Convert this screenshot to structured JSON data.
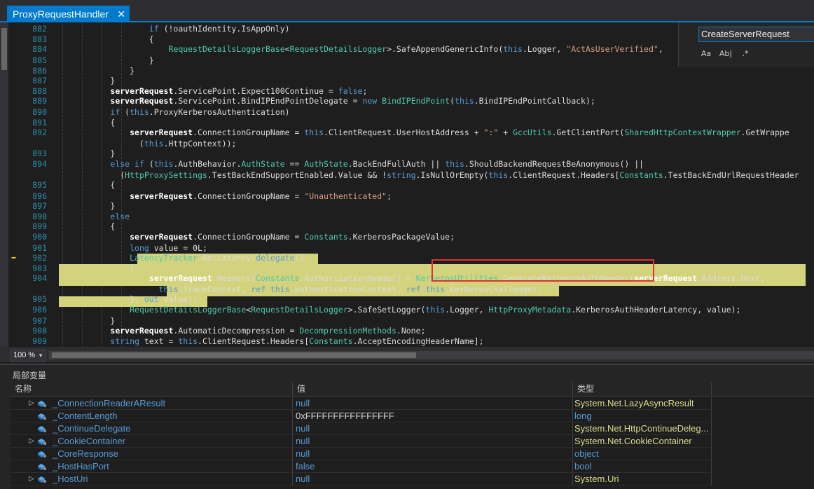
{
  "tab": {
    "title": "ProxyRequestHandler",
    "close": "✕"
  },
  "find": {
    "query": "CreateServerRequest",
    "opt_case": "Aa",
    "opt_word": "Ab|",
    "opt_regex": ".*"
  },
  "zoom": {
    "value": "100 %"
  },
  "code": {
    "lines": [
      {
        "n": "882",
        "t": "                if (!oauthIdentity.IsAppOnly)"
      },
      {
        "n": "883",
        "t": "                {"
      },
      {
        "n": "884",
        "t": "                    RequestDetailsLoggerBase<RequestDetailsLogger>.SafeAppendGenericInfo(this.Logger, \"ActAsUserVerified\","
      },
      {
        "n": "885",
        "t": "                }"
      },
      {
        "n": "886",
        "t": "            }"
      },
      {
        "n": "887",
        "t": "        }"
      },
      {
        "n": "888",
        "t": "        serverRequest.ServicePoint.Expect100Continue = false;"
      },
      {
        "n": "889",
        "t": "        serverRequest.ServicePoint.BindIPEndPointDelegate = new BindIPEndPoint(this.BindIPEndPointCallback);"
      },
      {
        "n": "890",
        "t": "        if (this.ProxyKerberosAuthentication)"
      },
      {
        "n": "891",
        "t": "        {"
      },
      {
        "n": "892",
        "t": "            serverRequest.ConnectionGroupName = this.ClientRequest.UserHostAddress + \":\" + GccUtils.GetClientPort(SharedHttpContextWrapper.GetWrappe"
      },
      {
        "n": "",
        "t": "              (this.HttpContext));"
      },
      {
        "n": "893",
        "t": "        }"
      },
      {
        "n": "894",
        "t": "        else if (this.AuthBehavior.AuthState == AuthState.BackEndFullAuth || this.ShouldBackendRequestBeAnonymous() ||"
      },
      {
        "n": "",
        "t": "          (HttpProxySettings.TestBackEndSupportEnabled.Value && !string.IsNullOrEmpty(this.ClientRequest.Headers[Constants.TestBackEndUrlRequestHeader"
      },
      {
        "n": "895",
        "t": "        {"
      },
      {
        "n": "896",
        "t": "            serverRequest.ConnectionGroupName = \"Unauthenticated\";"
      },
      {
        "n": "897",
        "t": "        }"
      },
      {
        "n": "898",
        "t": "        else"
      },
      {
        "n": "899",
        "t": "        {"
      },
      {
        "n": "900",
        "t": "            serverRequest.ConnectionGroupName = Constants.KerberosPackageValue;"
      },
      {
        "n": "901",
        "t": "            long value = 0L;"
      },
      {
        "n": "902",
        "t": "            LatencyTracker.GetLatency(delegate()"
      },
      {
        "n": "903",
        "t": "            {"
      },
      {
        "n": "904",
        "t": "                serverRequest.Headers[Constants.AuthorizationHeader] = KerberosUtilities.GenerateKerberosAuthHeader(serverRequest.Address.Host,"
      },
      {
        "n": "",
        "t": "                  this.TraceContext, ref this.authenticationContext, ref this.kerberosChallenge);"
      },
      {
        "n": "905",
        "t": "            }, out value);"
      },
      {
        "n": "906",
        "t": "            RequestDetailsLoggerBase<RequestDetailsLogger>.SafeSetLogger(this.Logger, HttpProxyMetadata.KerberosAuthHeaderLatency, value);"
      },
      {
        "n": "907",
        "t": "        }"
      },
      {
        "n": "908",
        "t": "        serverRequest.AutomaticDecompression = DecompressionMethods.None;"
      },
      {
        "n": "909",
        "t": "        string text = this.ClientRequest.Headers[Constants.AcceptEncodingHeaderName];"
      }
    ]
  },
  "locals": {
    "title": "局部变量",
    "headers": {
      "name": "名称",
      "value": "值",
      "type": "类型"
    },
    "rows": [
      {
        "expand": "▷",
        "name": "_ConnectionReaderAResult",
        "value": "null",
        "type_ns": "System.Net.",
        "type_name": "LazyAsyncResult"
      },
      {
        "expand": "",
        "name": "_ContentLength",
        "value": "0xFFFFFFFFFFFFFFFF",
        "type_ns": "",
        "type_name": "long"
      },
      {
        "expand": "",
        "name": "_ContinueDelegate",
        "value": "null",
        "type_ns": "System.Net.",
        "type_name": "HttpContinueDeleg..."
      },
      {
        "expand": "▷",
        "name": "_CookieContainer",
        "value": "null",
        "type_ns": "System.Net.",
        "type_name": "CookieContainer"
      },
      {
        "expand": "",
        "name": "_CoreResponse",
        "value": "null",
        "type_ns": "",
        "type_name": "object"
      },
      {
        "expand": "",
        "name": "_HostHasPort",
        "value": "false",
        "type_ns": "",
        "type_name": "bool"
      },
      {
        "expand": "▷",
        "name": "_HostUri",
        "value": "null",
        "type_ns": "System.",
        "type_name": "Uri"
      }
    ]
  },
  "colors": {
    "accent": "#007acc",
    "highlight": "#d3d37d",
    "redbox": "#e03030"
  }
}
